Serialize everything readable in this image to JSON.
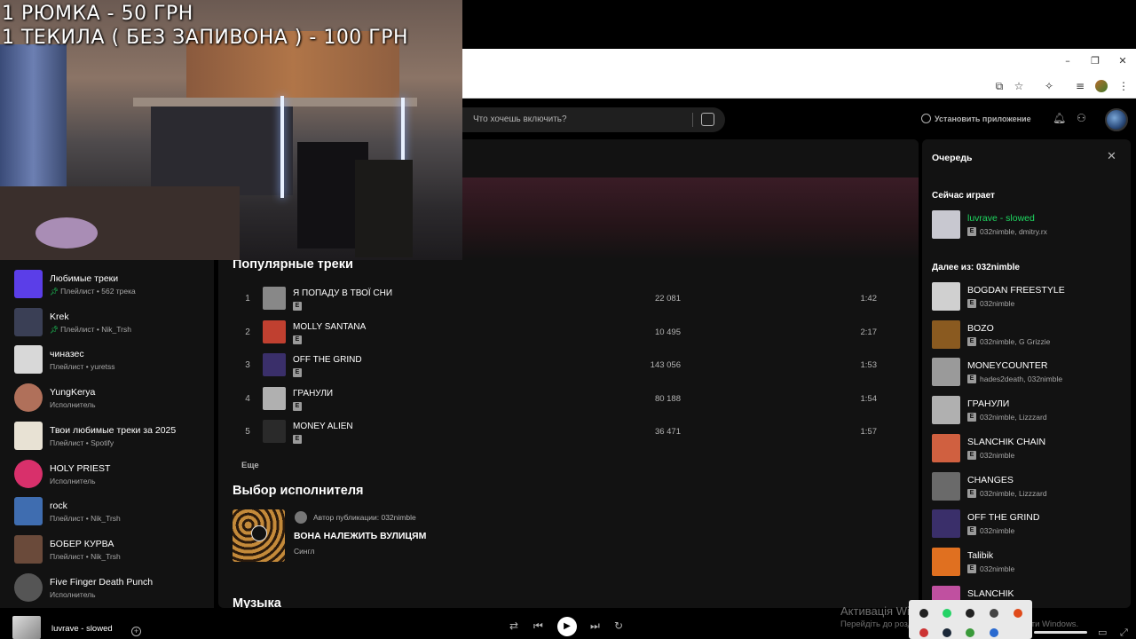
{
  "overlay": {
    "line1": "1 РЮМКА - 50 ГРН",
    "line2": "1 ТЕКИЛА ( БЕЗ ЗАПИВОНА ) - 100 ГРН"
  },
  "browser": {
    "minimize_icon": "minimize-icon",
    "maximize_icon": "maximize-icon",
    "close_icon": "close-icon"
  },
  "topbar": {
    "search_placeholder": "Что хочешь включить?",
    "install_label": "Установить приложение"
  },
  "library": {
    "items": [
      {
        "title": "Любимые треки",
        "subtitle": "Плейлист • 562 трека",
        "pinned": true,
        "color": "#5b3ee8"
      },
      {
        "title": "Krek",
        "subtitle": "Плейлист • Nik_Trsh",
        "pinned": true,
        "color": "#3a3f55"
      },
      {
        "title": "чиназес",
        "subtitle": "Плейлист • yuretss",
        "pinned": false,
        "color": "#d8d8d8"
      },
      {
        "title": "YungKerya",
        "subtitle": "Исполнитель",
        "pinned": false,
        "color": "#b0705a"
      },
      {
        "title": "Твои любимые треки за 2025",
        "subtitle": "Плейлист • Spotify",
        "pinned": false,
        "color": "#e8e2d4"
      },
      {
        "title": "HOLY PRIEST",
        "subtitle": "Исполнитель",
        "pinned": false,
        "color": "#d8306b"
      },
      {
        "title": "rock",
        "subtitle": "Плейлист • Nik_Trsh",
        "pinned": false,
        "color": "#3f6db0"
      },
      {
        "title": "БОБЕР КУРВА",
        "subtitle": "Плейлист • Nik_Trsh",
        "pinned": false,
        "color": "#6a4a3a"
      },
      {
        "title": "Five Finger Death Punch",
        "subtitle": "Исполнитель",
        "pinned": false,
        "color": "#555555"
      }
    ]
  },
  "main": {
    "popular_title": "Популярные треки",
    "tracks": [
      {
        "num": "1",
        "title": "Я ПОПАДУ В ТВОЇ СНИ",
        "explicit": "E",
        "plays": "22 081",
        "duration": "1:42",
        "color": "#888888"
      },
      {
        "num": "2",
        "title": "MOLLY SANTANA",
        "explicit": "E",
        "plays": "10 495",
        "duration": "2:17",
        "color": "#c04030"
      },
      {
        "num": "3",
        "title": "OFF THE GRIND",
        "explicit": "E",
        "plays": "143 056",
        "duration": "1:53",
        "color": "#3a2f6a"
      },
      {
        "num": "4",
        "title": "ГРАНУЛИ",
        "explicit": "E",
        "plays": "80 188",
        "duration": "1:54",
        "color": "#b0b0b0"
      },
      {
        "num": "5",
        "title": "MONEY ALIEN",
        "explicit": "E",
        "plays": "36 471",
        "duration": "1:57",
        "color": "#2a2a2a"
      }
    ],
    "more_label": "Еще",
    "pick_title": "Выбор исполнителя",
    "pick": {
      "author": "Автор публикации: 032nimble",
      "release": "ВОНА НАЛЕЖИТЬ ВУЛИЦЯМ",
      "type": "Сингл"
    },
    "music_title": "Музыка"
  },
  "queue": {
    "header": "Очередь",
    "now_playing_label": "Сейчас играет",
    "now_playing": {
      "title": "luvrave - slowed",
      "artists": "032nimble, dmitry.rx",
      "explicit": "E",
      "color": "#c8c8d0"
    },
    "next_label": "Далее из: 032nimble",
    "items": [
      {
        "title": "BOGDAN FREESTYLE",
        "artists": "032nimble",
        "explicit": "E",
        "color": "#d0d0d0"
      },
      {
        "title": "BOZO",
        "artists": "032nimble, G Grizzie",
        "explicit": "E",
        "color": "#8a5a20"
      },
      {
        "title": "MONEYCOUNTER",
        "artists": "hades2death, 032nimble",
        "explicit": "E",
        "color": "#9a9a9a"
      },
      {
        "title": "ГРАНУЛИ",
        "artists": "032nimble, Lizzzard",
        "explicit": "E",
        "color": "#b0b0b0"
      },
      {
        "title": "SLANCHIK CHAIN",
        "artists": "032nimble",
        "explicit": "E",
        "color": "#d06040"
      },
      {
        "title": "CHANGES",
        "artists": "032nimble, Lizzzard",
        "explicit": "E",
        "color": "#6a6a6a"
      },
      {
        "title": "OFF THE GRIND",
        "artists": "032nimble",
        "explicit": "E",
        "color": "#3a2f6a"
      },
      {
        "title": "Talibik",
        "artists": "032nimble",
        "explicit": "E",
        "color": "#e07020"
      },
      {
        "title": "SLANCHIK",
        "artists": "",
        "explicit": "",
        "color": "#c050a0"
      }
    ]
  },
  "player": {
    "now_playing_title": "luvrave - slowed"
  },
  "windows": {
    "activation_title": "Активація Windows",
    "activation_sub": "Перейдіть до розділу \"Настройки\", щоб активувати Windows."
  }
}
